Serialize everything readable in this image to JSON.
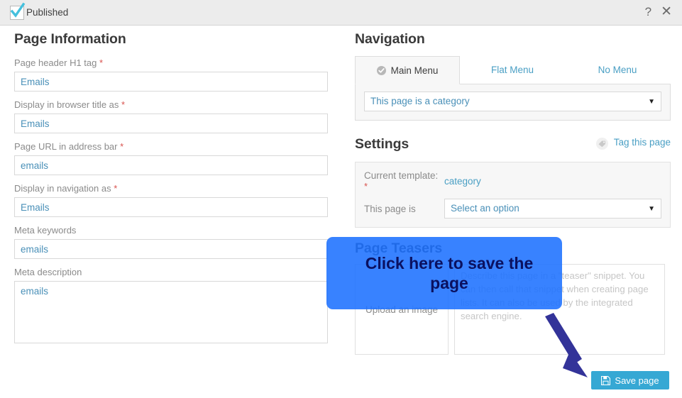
{
  "topbar": {
    "published_label": "Published",
    "published_checked": true,
    "help_icon": "question-mark-icon",
    "close_icon": "close-icon",
    "help_glyph": "?",
    "close_glyph": "✕"
  },
  "page_information": {
    "heading": "Page Information",
    "fields": [
      {
        "label": "Page header H1 tag",
        "required": true,
        "value": "Emails",
        "name": "page-header-h1-input"
      },
      {
        "label": "Display in browser title as",
        "required": true,
        "value": "Emails",
        "name": "browser-title-input"
      },
      {
        "label": "Page URL in address bar",
        "required": true,
        "value": "emails",
        "name": "page-url-input"
      },
      {
        "label": "Display in navigation as",
        "required": true,
        "value": "Emails",
        "name": "navigation-title-input"
      },
      {
        "label": "Meta keywords",
        "required": false,
        "value": "emails",
        "name": "meta-keywords-input"
      },
      {
        "label": "Meta description",
        "required": false,
        "value": "emails",
        "name": "meta-description-textarea"
      }
    ],
    "required_marker": "*"
  },
  "navigation": {
    "heading": "Navigation",
    "tabs": [
      {
        "label": "Main Menu",
        "active": true,
        "icon": "check-circle-icon"
      },
      {
        "label": "Flat Menu",
        "active": false
      },
      {
        "label": "No Menu",
        "active": false
      }
    ],
    "menu_select": {
      "value": "This page is a category",
      "caret": "▼"
    }
  },
  "settings": {
    "heading": "Settings",
    "tag_link": {
      "label": "Tag this page",
      "icon": "tag-icon"
    },
    "current_template": {
      "label": "Current template:",
      "required_marker": "*",
      "value": "category"
    },
    "page_is": {
      "label": "This page is",
      "select_value": "Select an option",
      "caret": "▼"
    }
  },
  "page_teasers": {
    "heading": "Page Teasers",
    "upload_box_label": "Upload an image",
    "teaser_text": "Describe this page in a \"teaser\" snippet. You can then call that snippet when creating page lists. It can also be used by the integrated search engine."
  },
  "footer": {
    "save_label": "Save page",
    "save_icon": "floppy-disk-icon"
  },
  "annotation": {
    "callout_text": "Click here to save the page",
    "arrow_icon": "arrow-down-right-icon"
  },
  "colors": {
    "accent_blue": "#36a8d4",
    "link_blue": "#4a9fc4",
    "field_text": "#4a90b8",
    "required_red": "#d9534f",
    "callout_blue": "#1d71ff",
    "callout_text": "#0a1160",
    "arrow_navy": "#333399",
    "topbar_bg": "#ececec",
    "panel_bg": "#f7f7f7"
  }
}
